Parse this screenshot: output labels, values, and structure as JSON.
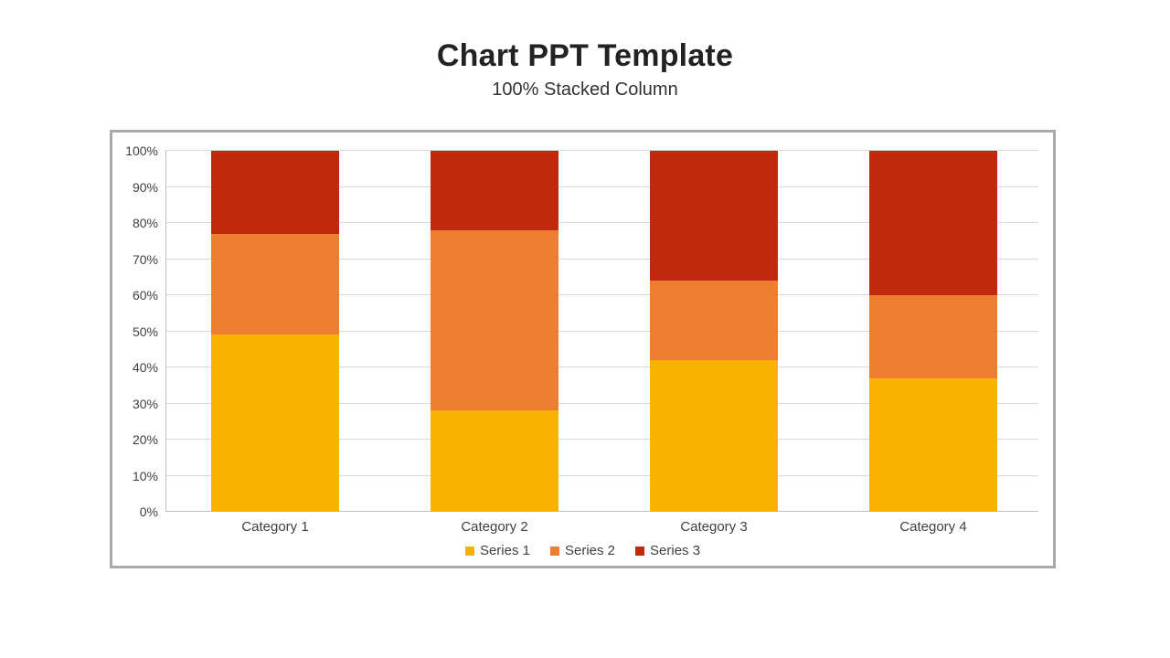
{
  "title": "Chart PPT Template",
  "subtitle": "100% Stacked Column",
  "chart_data": {
    "type": "bar",
    "stacked": "100%",
    "categories": [
      "Category 1",
      "Category 2",
      "Category 3",
      "Category 4"
    ],
    "series": [
      {
        "name": "Series 1",
        "color": "#f9b200",
        "values": [
          49,
          28,
          42,
          37
        ]
      },
      {
        "name": "Series 2",
        "color": "#ed7d31",
        "values": [
          28,
          50,
          22,
          23
        ]
      },
      {
        "name": "Series 3",
        "color": "#c0290e",
        "values": [
          23,
          22,
          36,
          40
        ]
      }
    ],
    "title": "",
    "xlabel": "",
    "ylabel": "",
    "ylim": [
      0,
      100
    ],
    "y_ticks": [
      "0%",
      "10%",
      "20%",
      "30%",
      "40%",
      "50%",
      "60%",
      "70%",
      "80%",
      "90%",
      "100%"
    ],
    "grid": true,
    "legend_position": "bottom"
  }
}
